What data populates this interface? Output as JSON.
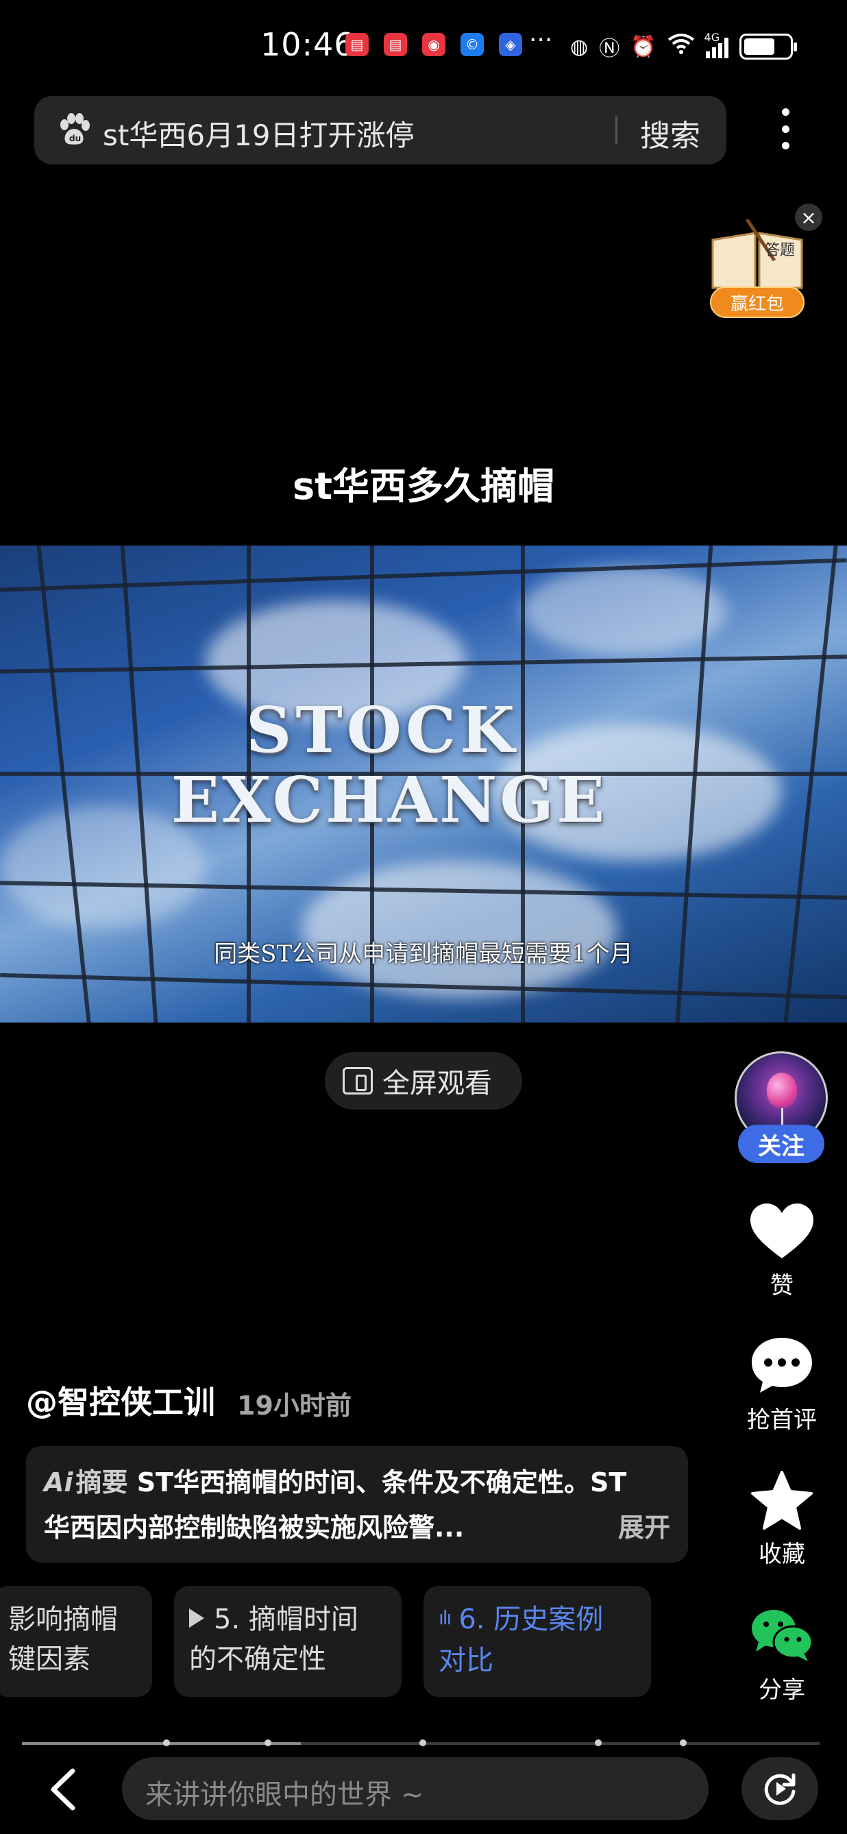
{
  "status_bar": {
    "time": "10:46",
    "more": "···",
    "network": "4G",
    "app_icons": [
      "red-book-icon",
      "red-book-icon",
      "red-target-icon",
      "blue-c-icon",
      "blue-shield-icon"
    ]
  },
  "search": {
    "query": "st华西6月19日打开涨停",
    "button": "搜索"
  },
  "promo": {
    "book_text": "答题",
    "label": "赢红包"
  },
  "video": {
    "title": "st华西多久摘帽",
    "scene_line1": "STOCK",
    "scene_line2": "EXCHANGE",
    "subtitle": "同类ST公司从申请到摘帽最短需要1个月",
    "fullscreen_label": "全屏观看"
  },
  "rail": {
    "follow": "关注",
    "like": "赞",
    "comment": "抢首评",
    "favorite": "收藏",
    "share": "分享"
  },
  "post": {
    "author": "@智控侠工训",
    "time_ago": "19小时前",
    "summary_tag": "摘要",
    "summary_logo": "Ai",
    "summary_line1": "ST华西摘帽的时间、条件及不确定性。ST",
    "summary_line2": "华西因内部控制缺陷被实施风险警...",
    "expand": "展开"
  },
  "chapters": [
    {
      "line1": "影响摘帽",
      "line2": "键因素"
    },
    {
      "line1": "5. 摘帽时间",
      "line2": "的不确定性"
    },
    {
      "line1": "6. 历史案例",
      "line2": "对比"
    }
  ],
  "progress": {
    "played_fraction": 0.35
  },
  "bottom": {
    "comment_placeholder": "来讲讲你眼中的世界 ~"
  },
  "colors": {
    "accent": "#3e6ce6",
    "background": "#000000",
    "chip_bg": "#1c1c1c",
    "promo_orange": "#f08a1c"
  }
}
